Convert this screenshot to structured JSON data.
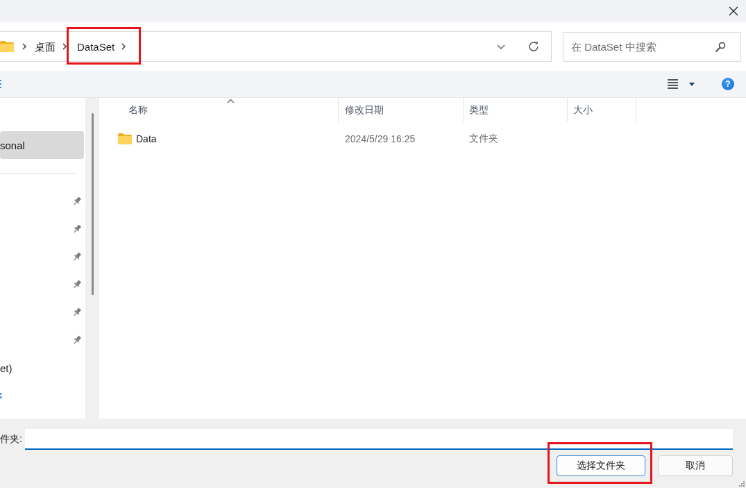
{
  "address_bar": {
    "crumbs": [
      {
        "label": "桌面",
        "annotated": false
      },
      {
        "label": "DataSet",
        "annotated": true
      }
    ]
  },
  "search": {
    "placeholder": "在 DataSet 中搜索"
  },
  "toolbar": {
    "help": "?"
  },
  "nav_pane": {
    "sections": [
      {
        "items": [
          {
            "kind": "label",
            "label": "sonal",
            "selected": true
          }
        ]
      },
      {
        "items": [
          {
            "kind": "pin",
            "selected": false
          },
          {
            "kind": "pin",
            "selected": false
          },
          {
            "kind": "pin",
            "selected": false
          },
          {
            "kind": "pin",
            "selected": false
          },
          {
            "kind": "pin",
            "selected": false
          },
          {
            "kind": "pin",
            "selected": false
          },
          {
            "kind": "label",
            "label": "et)",
            "selected": false
          },
          {
            "kind": "icon",
            "selected": false
          }
        ]
      }
    ]
  },
  "file_list": {
    "columns": [
      {
        "label": "名称",
        "sorted": true
      },
      {
        "label": "修改日期",
        "sorted": false
      },
      {
        "label": "类型",
        "sorted": false
      },
      {
        "label": "大小",
        "sorted": false
      }
    ],
    "rows": [
      {
        "name": "Data",
        "modified": "2024/5/29 16:25",
        "type": "文件夹"
      }
    ]
  },
  "footer": {
    "label": "件夹:",
    "buttons": [
      {
        "label": "选择文件夹",
        "default": true,
        "annotated": true
      },
      {
        "label": "取消",
        "default": false,
        "annotated": false
      }
    ]
  }
}
